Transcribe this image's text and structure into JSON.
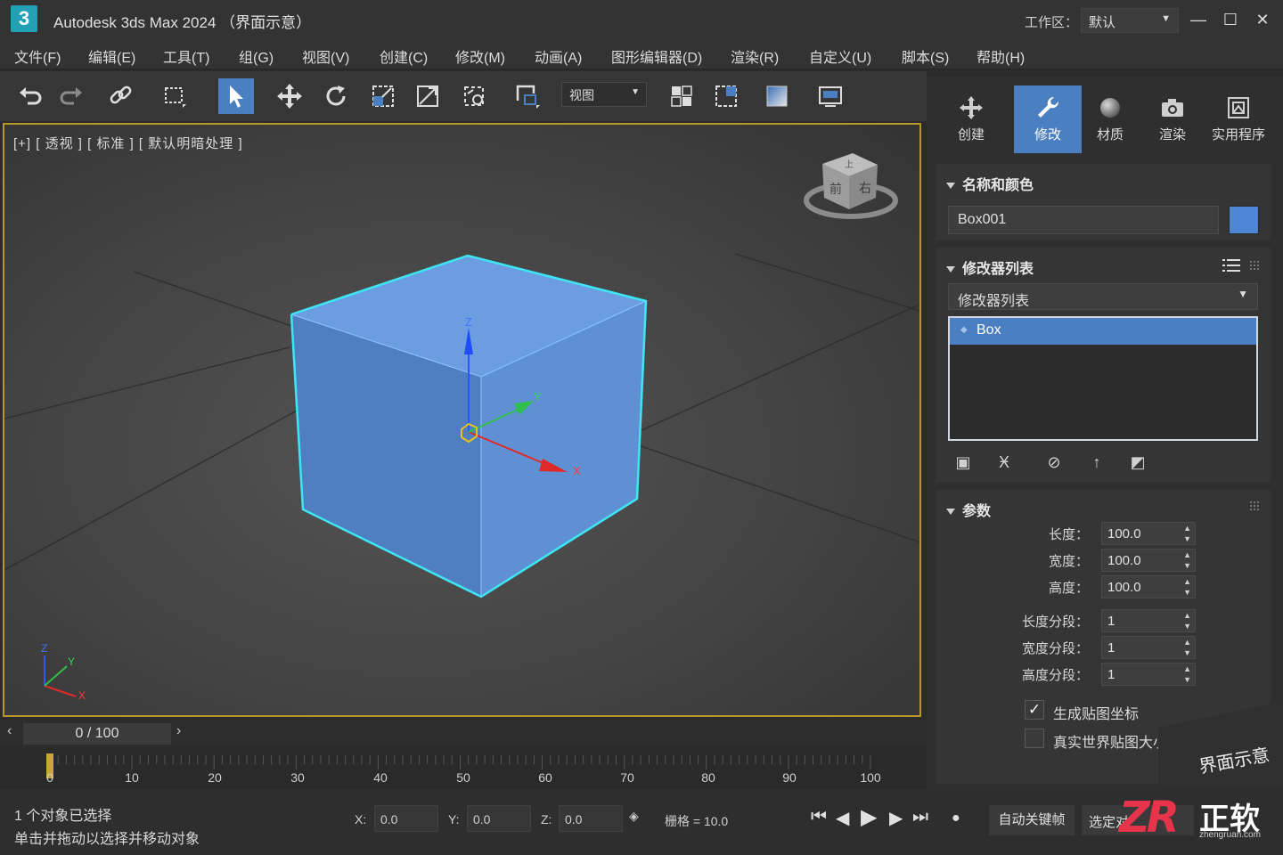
{
  "title_bar": {
    "logo": "3",
    "app_title": "Autodesk 3ds Max 2024  （界面示意）",
    "workspace_label": "工作区：",
    "workspace_value": "默认",
    "window_controls": [
      "minimize-icon",
      "maximize-icon",
      "close-icon"
    ]
  },
  "menu": [
    "文件(F)",
    "编辑(E)",
    "工具(T)",
    "组(G)",
    "视图(V)",
    "创建(C)",
    "修改(M)",
    "动画(A)",
    "图形编辑器(D)",
    "渲染(R)",
    "自定义(U)",
    "脚本(S)",
    "帮助(H)"
  ],
  "toolbar": {
    "icons": [
      "undo-icon",
      "redo-icon",
      "link-icon",
      "select-region-icon",
      "select-object-icon",
      "move-icon",
      "rotate-icon",
      "scale-icon",
      "scale-nonuniform-icon",
      "place-icon",
      "selection-window-icon",
      "snap-icon",
      "mirror-icon",
      "material-editor-icon",
      "render-frame-icon"
    ],
    "active_tool": "select-object-icon",
    "reference_coord": "视图",
    "accent": "#4a7fc1"
  },
  "viewport": {
    "label": "[+] [ 透视 ] [ 标准 ] [ 默认明暗处理 ]",
    "border_color": "#b8962e",
    "object_color": "#5b8fd6",
    "selection_edge_color": "#3ee6f5",
    "viewcube": {
      "top": "上",
      "front": "前",
      "right": "右"
    },
    "gizmo_axes": [
      "X",
      "Y",
      "Z"
    ],
    "corner_axes": [
      "X",
      "Y",
      "Z"
    ]
  },
  "command_panel": {
    "tabs": [
      {
        "label": "创建",
        "icon": "create-icon"
      },
      {
        "label": "修改",
        "icon": "modify-wrench-icon"
      },
      {
        "label": "材质",
        "icon": "material-sphere-icon"
      },
      {
        "label": "渲染",
        "icon": "render-camera-icon"
      },
      {
        "label": "实用程序",
        "icon": "utilities-icon"
      }
    ],
    "active_tab": "修改",
    "name_color": {
      "header": "名称和颜色",
      "object_name": "Box001",
      "color": "#4f86d4"
    },
    "modifier_list": {
      "header": "修改器列表",
      "dropdown": "修改器列表",
      "stack": [
        "Box"
      ],
      "stack_buttons": [
        "pin-stack-icon",
        "show-end-result-icon",
        "make-unique-icon",
        "remove-modifier-icon",
        "configure-sets-icon"
      ]
    },
    "parameters": {
      "header": "参数",
      "fields": [
        {
          "label": "长度：",
          "value": "100.0"
        },
        {
          "label": "宽度：",
          "value": "100.0"
        },
        {
          "label": "高度：",
          "value": "100.0"
        },
        {
          "label": "长度分段：",
          "value": "1"
        },
        {
          "label": "宽度分段：",
          "value": "1"
        },
        {
          "label": "高度分段：",
          "value": "1"
        }
      ],
      "checkboxes": [
        {
          "label": "生成贴图坐标",
          "checked": true
        },
        {
          "label": "真实世界贴图大小",
          "checked": false
        }
      ]
    }
  },
  "timeline": {
    "slider": "0 / 100",
    "current_frame": 0,
    "ticks": [
      "0",
      "10",
      "20",
      "30",
      "40",
      "50",
      "60",
      "70",
      "80",
      "90",
      "100"
    ]
  },
  "status_bar": {
    "selection_text": "1 个对象已选择",
    "hint_text": "单击并拖动以选择并移动对象",
    "x_label": "X:",
    "x_value": "0.0",
    "y_label": "Y:",
    "y_value": "0.0",
    "z_label": "Z:",
    "z_value": "0.0",
    "grid": "栅格 = 10.0",
    "playback_icons": [
      "go-to-start-icon",
      "prev-frame-icon",
      "play-icon",
      "next-frame-icon",
      "go-to-end-icon",
      "set-key-icon"
    ],
    "auto_key": "自动关键帧",
    "selected_set": "选定对"
  },
  "watermark": {
    "caption": "界面示意",
    "brand_mark": "ZR",
    "brand_name": "正软",
    "brand_url": "zhengruan.com"
  }
}
